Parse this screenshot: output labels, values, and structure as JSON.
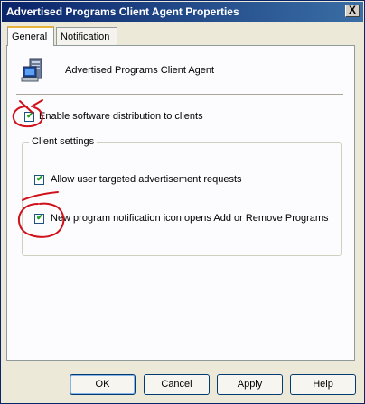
{
  "window": {
    "title": "Advertised Programs Client Agent Properties",
    "close_glyph": "X"
  },
  "tabs": [
    {
      "label": "General",
      "selected": true
    },
    {
      "label": "Notification",
      "selected": false
    }
  ],
  "header": {
    "icon": "computer-icon",
    "title": "Advertised Programs Client Agent"
  },
  "options": {
    "enable_distribution": {
      "label": "Enable software distribution to clients",
      "checked": true
    }
  },
  "client_settings": {
    "title": "Client settings",
    "allow_user_targeted": {
      "label": "Allow user targeted advertisement requests",
      "checked": true
    },
    "new_program_notification": {
      "label": "New program notification icon opens Add or Remove Programs",
      "checked": true
    }
  },
  "buttons": {
    "ok": "OK",
    "cancel": "Cancel",
    "apply": "Apply",
    "help": "Help"
  },
  "annotations": {
    "color": "#d0101a"
  }
}
